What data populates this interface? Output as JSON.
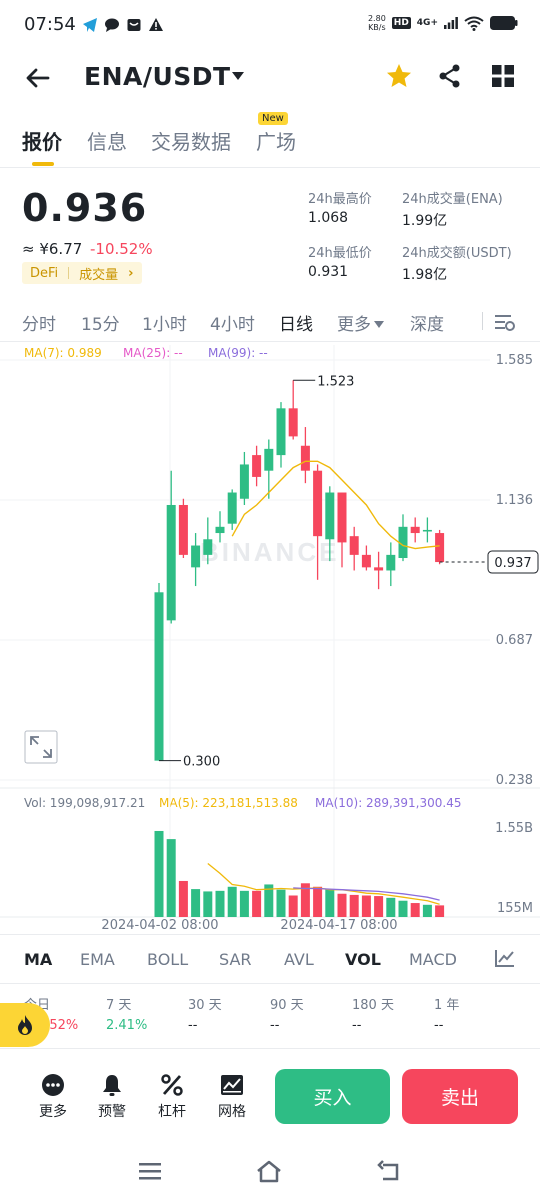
{
  "status_bar": {
    "time": "07:54",
    "speed_value": "2.80",
    "speed_unit": "KB/s",
    "hd": "HD",
    "network": "4G+"
  },
  "header": {
    "pair": "ENA/USDT"
  },
  "tabs": [
    {
      "label": "报价"
    },
    {
      "label": "信息"
    },
    {
      "label": "交易数据"
    },
    {
      "label": "广场"
    }
  ],
  "new_badge": "New",
  "price": {
    "last": "0.936",
    "cny": "≈ ¥6.77",
    "change": "-10.52%",
    "tag_category": "DeFi",
    "tag_metric": "成交量",
    "tag_arrow": "›"
  },
  "stats": {
    "high_label": "24h最高价",
    "high_value": "1.068",
    "low_label": "24h最低价",
    "low_value": "0.931",
    "vol_label": "24h成交量(ENA)",
    "vol_value": "1.99亿",
    "turnover_label": "24h成交额(USDT)",
    "turnover_value": "1.98亿"
  },
  "intervals": [
    "分时",
    "15分",
    "1小时",
    "4小时",
    "日线",
    "更多",
    "深度"
  ],
  "active_interval": "日线",
  "ma_legend": {
    "ma7": "MA(7): 0.989",
    "ma25": "MA(25): --",
    "ma99": "MA(99): --"
  },
  "vol_legend": {
    "vol": "Vol: 199,098,917.21",
    "ma5": "MA(5): 223,181,513.88",
    "ma10": "MA(10): 289,391,300.45"
  },
  "watermark": "BINANCE",
  "chart_data": [
    {
      "type": "candlestick",
      "title": "",
      "y_ticks": [
        "1.585",
        "1.136",
        "0.687",
        "0.238"
      ],
      "ylim": [
        0.238,
        1.585
      ],
      "x_tick_labels": [
        "2024-04-02 08:00",
        "2024-04-17 08:00"
      ],
      "high_marker": "1.523",
      "low_marker": "0.300",
      "last_price_marker": "0.937",
      "colors": {
        "up": "#2ebd85",
        "down": "#f6465d",
        "ma7": "#f0b90b",
        "ma25": "#e55ac8",
        "ma99": "#8b6ddc"
      },
      "candles": [
        {
          "o": 0.84,
          "h": 0.87,
          "l": 0.3,
          "c": 0.3,
          "dir": "up"
        },
        {
          "o": 0.75,
          "h": 1.23,
          "l": 0.74,
          "c": 1.12,
          "dir": "up"
        },
        {
          "o": 1.12,
          "h": 1.14,
          "l": 0.95,
          "c": 0.96,
          "dir": "down"
        },
        {
          "o": 0.92,
          "h": 1.03,
          "l": 0.86,
          "c": 0.99,
          "dir": "up"
        },
        {
          "o": 0.96,
          "h": 1.08,
          "l": 0.93,
          "c": 1.01,
          "dir": "up"
        },
        {
          "o": 1.05,
          "h": 1.1,
          "l": 1.0,
          "c": 1.03,
          "dir": "up"
        },
        {
          "o": 1.06,
          "h": 1.17,
          "l": 1.04,
          "c": 1.16,
          "dir": "up"
        },
        {
          "o": 1.14,
          "h": 1.29,
          "l": 1.12,
          "c": 1.25,
          "dir": "up"
        },
        {
          "o": 1.28,
          "h": 1.31,
          "l": 1.18,
          "c": 1.21,
          "dir": "down"
        },
        {
          "o": 1.23,
          "h": 1.33,
          "l": 1.14,
          "c": 1.3,
          "dir": "up"
        },
        {
          "o": 1.28,
          "h": 1.45,
          "l": 1.24,
          "c": 1.43,
          "dir": "up"
        },
        {
          "o": 1.43,
          "h": 1.52,
          "l": 1.33,
          "c": 1.34,
          "dir": "down"
        },
        {
          "o": 1.31,
          "h": 1.37,
          "l": 1.19,
          "c": 1.23,
          "dir": "down"
        },
        {
          "o": 1.23,
          "h": 1.25,
          "l": 0.88,
          "c": 1.02,
          "dir": "down"
        },
        {
          "o": 1.01,
          "h": 1.18,
          "l": 0.94,
          "c": 1.16,
          "dir": "up"
        },
        {
          "o": 1.16,
          "h": 1.16,
          "l": 0.92,
          "c": 1.0,
          "dir": "down"
        },
        {
          "o": 1.02,
          "h": 1.05,
          "l": 0.91,
          "c": 0.96,
          "dir": "down"
        },
        {
          "o": 0.96,
          "h": 0.99,
          "l": 0.91,
          "c": 0.92,
          "dir": "down"
        },
        {
          "o": 0.92,
          "h": 0.97,
          "l": 0.85,
          "c": 0.91,
          "dir": "down"
        },
        {
          "o": 0.91,
          "h": 1.0,
          "l": 0.86,
          "c": 0.96,
          "dir": "up"
        },
        {
          "o": 0.95,
          "h": 1.09,
          "l": 0.94,
          "c": 1.05,
          "dir": "up"
        },
        {
          "o": 1.05,
          "h": 1.08,
          "l": 1.0,
          "c": 1.03,
          "dir": "down"
        },
        {
          "o": 1.04,
          "h": 1.08,
          "l": 1.0,
          "c": 1.035,
          "dir": "up"
        },
        {
          "o": 1.03,
          "h": 1.04,
          "l": 0.93,
          "c": 0.937,
          "dir": "down"
        }
      ],
      "ma7": [
        null,
        null,
        null,
        null,
        null,
        null,
        1.02,
        1.09,
        1.12,
        1.16,
        1.2,
        1.24,
        1.26,
        1.26,
        1.24,
        1.2,
        1.16,
        1.12,
        1.06,
        1.02,
        0.99,
        0.98,
        0.985,
        0.989
      ]
    },
    {
      "type": "bar",
      "title": "Volume",
      "y_ticks": [
        "1.55B",
        "155M"
      ],
      "ylim": [
        0,
        1.6
      ],
      "unit": "B",
      "values": [
        1.48,
        1.34,
        0.62,
        0.48,
        0.44,
        0.45,
        0.52,
        0.45,
        0.45,
        0.56,
        0.47,
        0.37,
        0.58,
        0.52,
        0.48,
        0.4,
        0.38,
        0.37,
        0.36,
        0.33,
        0.28,
        0.24,
        0.21,
        0.2
      ],
      "ma5": [
        null,
        null,
        null,
        null,
        0.92,
        0.75,
        0.56,
        0.53,
        0.47,
        0.48,
        0.49,
        0.48,
        0.49,
        0.5,
        0.47,
        0.47,
        0.44,
        0.41,
        0.4,
        0.37,
        0.34,
        0.31,
        0.28,
        0.22
      ],
      "ma10": [
        null,
        null,
        null,
        null,
        null,
        null,
        null,
        null,
        null,
        null,
        null,
        0.5,
        0.49,
        0.49,
        0.48,
        0.47,
        0.46,
        0.45,
        0.44,
        0.42,
        0.4,
        0.37,
        0.34,
        0.29
      ]
    }
  ],
  "indicators": [
    "MA",
    "EMA",
    "BOLL",
    "SAR",
    "AVL",
    "VOL",
    "MACD"
  ],
  "performance": [
    {
      "label": "今日",
      "value": "-10.52%",
      "color": "#f6465d"
    },
    {
      "label": "7 天",
      "value": "2.41%",
      "color": "#2ebd85"
    },
    {
      "label": "30 天",
      "value": "--",
      "color": "#1e2329"
    },
    {
      "label": "90 天",
      "value": "--",
      "color": "#1e2329"
    },
    {
      "label": "180 天",
      "value": "--",
      "color": "#1e2329"
    },
    {
      "label": "1 年",
      "value": "--",
      "color": "#1e2329"
    }
  ],
  "bottom": {
    "more": "更多",
    "alert": "预警",
    "leverage": "杠杆",
    "grid": "网格",
    "buy": "买入",
    "sell": "卖出"
  }
}
